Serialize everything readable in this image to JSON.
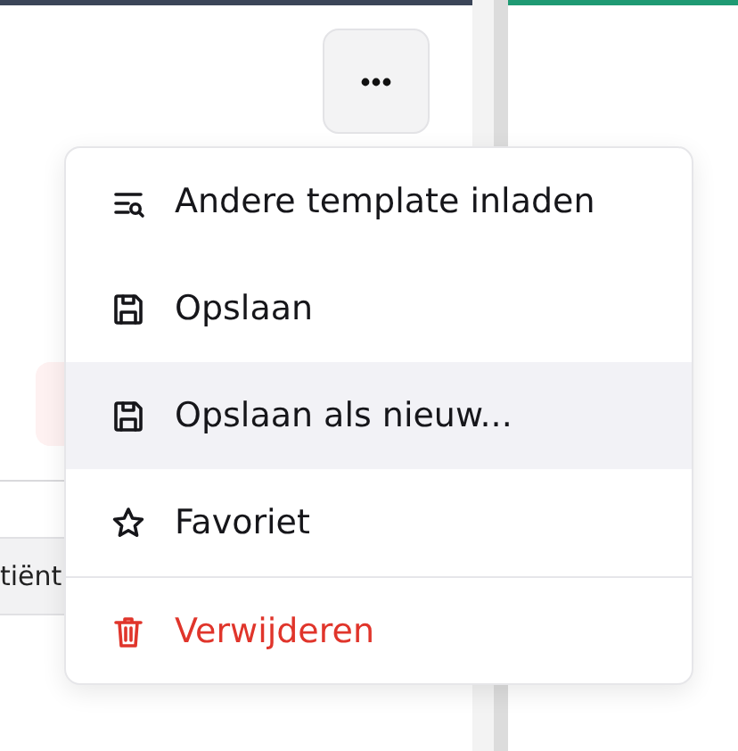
{
  "background": {
    "chip": {
      "label": "tiënt"
    }
  },
  "menu": {
    "items": [
      {
        "kind": "list-search",
        "label": "Andere template inladen",
        "selected": false,
        "danger": false,
        "divider_before": false
      },
      {
        "kind": "save",
        "label": "Opslaan",
        "selected": false,
        "danger": false,
        "divider_before": false
      },
      {
        "kind": "save",
        "label": "Opslaan als nieuw...",
        "selected": true,
        "danger": false,
        "divider_before": false
      },
      {
        "kind": "star",
        "label": "Favoriet",
        "selected": false,
        "danger": false,
        "divider_before": false
      },
      {
        "kind": "trash",
        "label": "Verwijderen",
        "selected": false,
        "danger": true,
        "divider_before": true
      }
    ]
  }
}
